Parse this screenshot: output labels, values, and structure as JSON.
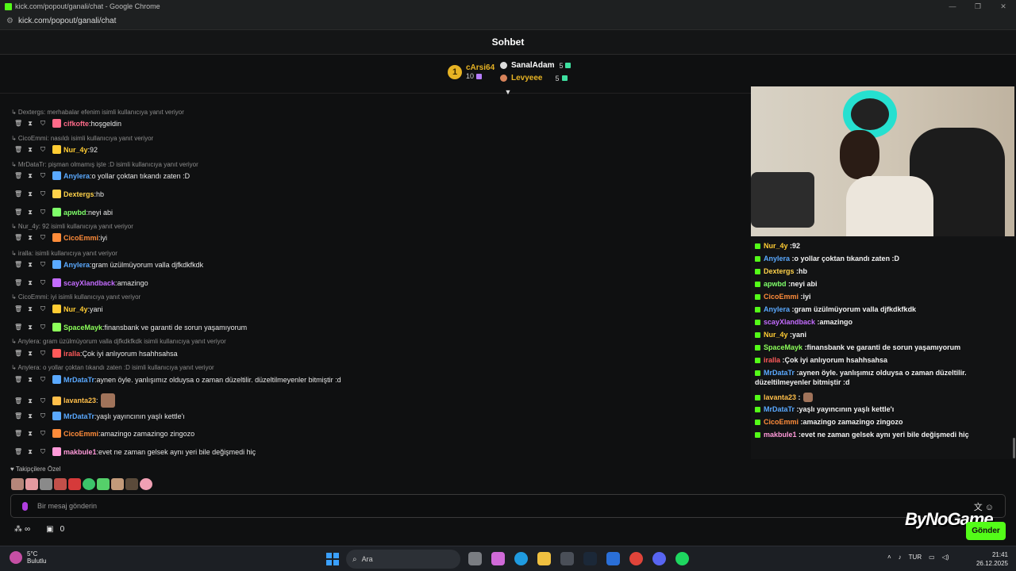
{
  "browser": {
    "window_title": "kick.com/popout/ganali/chat - Google Chrome",
    "url": "kick.com/popout/ganali/chat"
  },
  "chat_header": {
    "title": "Sohbet"
  },
  "leaderboard": {
    "first": {
      "rank": "1",
      "name": "cArsi64",
      "count": "10"
    },
    "second": {
      "name": "SanalAdam",
      "count": "5"
    },
    "third": {
      "name": "Levyeee",
      "count": "5"
    }
  },
  "messages": [
    {
      "type": "reply",
      "text": "Dextergs: merhabalar efenim isimli kullanıcıya yanıt veriyor"
    },
    {
      "type": "msg",
      "user": "cifkofte",
      "text": "hoşgeldin",
      "color": "#ff6b8a"
    },
    {
      "type": "reply",
      "text": "CicoEmmi: nasıldı isimli kullanıcıya yanıt veriyor"
    },
    {
      "type": "msg",
      "user": "Nur_4y",
      "text": "92",
      "color": "#ffcc33"
    },
    {
      "type": "reply",
      "text": "MrDataTr: pişman olmamış işte :D isimli kullanıcıya yanıt veriyor"
    },
    {
      "type": "msg",
      "user": "Anylera",
      "text": "o yollar çoktan tıkandı zaten :D",
      "color": "#5aa9ff"
    },
    {
      "type": "msg",
      "user": "Dextergs",
      "text": "hb",
      "color": "#ffd24a"
    },
    {
      "type": "msg",
      "user": "apwbd",
      "text": "neyi abi",
      "color": "#7fff6a"
    },
    {
      "type": "reply",
      "text": "Nur_4y: 92 isimli kullanıcıya yanıt veriyor"
    },
    {
      "type": "msg",
      "user": "CicoEmmi",
      "text": "iyi",
      "color": "#ff8c3a"
    },
    {
      "type": "reply",
      "text": "iralla: isimli kullanıcıya yanıt veriyor"
    },
    {
      "type": "msg",
      "user": "Anylera",
      "text": "gram üzülmüyorum valla djfkdkfkdk",
      "color": "#5aa9ff"
    },
    {
      "type": "msg",
      "user": "scayXlandback",
      "text": "amazingo",
      "color": "#c46cff"
    },
    {
      "type": "reply",
      "text": "CicoEmmi: iyi isimli kullanıcıya yanıt veriyor"
    },
    {
      "type": "msg",
      "user": "Nur_4y",
      "text": "yani",
      "color": "#ffcc33"
    },
    {
      "type": "msg",
      "user": "SpaceMayk",
      "text": "finansbank ve garanti de sorun yaşamıyorum",
      "color": "#8cff5a"
    },
    {
      "type": "reply",
      "text": "Anylera: gram üzülmüyorum valla djfkdkfkdk isimli kullanıcıya yanıt veriyor"
    },
    {
      "type": "msg",
      "user": "iralla",
      "text": "Çok iyi anlıyorum hsahhsahsa",
      "color": "#ff5a5a"
    },
    {
      "type": "reply",
      "text": "Anylera: o yollar çoktan tıkandı zaten :D isimli kullanıcıya yanıt veriyor"
    },
    {
      "type": "msg",
      "user": "MrDataTr",
      "text": "aynen öyle. yanlışımız olduysa o zaman düzeltilir. düzeltilmeyenler bitmiştir :d",
      "color": "#5aa9ff"
    },
    {
      "type": "msg",
      "user": "lavanta23",
      "text": "",
      "color": "#ffbf4a"
    },
    {
      "type": "msg",
      "user": "MrDataTr",
      "text": "yaşlı yayıncının yaşlı kettle'ı",
      "color": "#5aa9ff"
    },
    {
      "type": "msg",
      "user": "CicoEmmi",
      "text": "amazingo zamazingo zingozo",
      "color": "#ff8c3a"
    },
    {
      "type": "msg",
      "user": "makbule1",
      "text": "evet ne zaman gelsek aynı yeri bile değişmedi hiç",
      "color": "#ff9ad9"
    }
  ],
  "stream_chat": [
    {
      "user": "Nur_4y",
      "text": "92",
      "color": "#ffcc33"
    },
    {
      "user": "Anylera",
      "text": "o yollar çoktan tıkandı zaten :D",
      "color": "#5aa9ff"
    },
    {
      "user": "Dextergs",
      "text": "hb",
      "color": "#ffd24a"
    },
    {
      "user": "apwbd",
      "text": "neyi abi",
      "color": "#7fff6a"
    },
    {
      "user": "CicoEmmi",
      "text": "iyi",
      "color": "#ff8c3a"
    },
    {
      "user": "Anylera",
      "text": "gram üzülmüyorum valla djfkdkfkdk",
      "color": "#5aa9ff"
    },
    {
      "user": "scayXlandback",
      "text": "amazingo",
      "color": "#c46cff"
    },
    {
      "user": "Nur_4y",
      "text": "yani",
      "color": "#ffcc33"
    },
    {
      "user": "SpaceMayk",
      "text": "finansbank ve garanti de sorun yaşamıyorum",
      "color": "#8cff5a"
    },
    {
      "user": "iralla",
      "text": "Çok iyi anlıyorum hsahhsahsa",
      "color": "#ff5a5a"
    },
    {
      "user": "MrDataTr",
      "text": "aynen öyle. yanlışımız olduysa o zaman düzeltilir.",
      "color": "#5aa9ff"
    },
    {
      "user": "",
      "text": "düzeltilmeyenler bitmiştir :d",
      "color": "#ffffff"
    },
    {
      "user": "lavanta23",
      "text": "",
      "color": "#ffbf4a"
    },
    {
      "user": "MrDataTr",
      "text": "yaşlı yayıncının yaşlı kettle'ı",
      "color": "#5aa9ff"
    },
    {
      "user": "CicoEmmi",
      "text": "amazingo zamazingo zingozo",
      "color": "#ff8c3a"
    },
    {
      "user": "makbule1",
      "text": "evet ne zaman gelsek aynı yeri bile değişmedi hiç",
      "color": "#ff9ad9"
    }
  ],
  "emote_section": {
    "label": "Takipçilere Özel"
  },
  "composer": {
    "placeholder": "Bir mesaj gönderin",
    "send_label": "Gönder"
  },
  "footer": {
    "infinity": "∞",
    "gift_count": "0"
  },
  "watermark": {
    "text": "ByNoGame"
  },
  "taskbar": {
    "weather_temp": "5°C",
    "weather_desc": "Bulutlu",
    "search_placeholder": "Ara",
    "language": "TUR",
    "time": "21:41",
    "date": "26.12.2025"
  },
  "colors": {
    "kick_green": "#53fc18",
    "background": "#0f1011"
  }
}
